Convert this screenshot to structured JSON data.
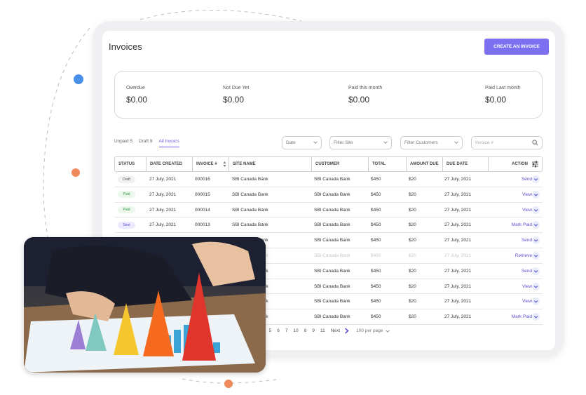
{
  "page": {
    "title": "Invoices",
    "create_label": "CREATE AN INVOICE"
  },
  "summary": [
    {
      "label": "Overdue",
      "value": "$0.00"
    },
    {
      "label": "Not Due Yet",
      "value": "$0.00"
    },
    {
      "label": "Paid this month",
      "value": "$0.00"
    },
    {
      "label": "Paid Last month",
      "value": "$0.00"
    }
  ],
  "tabs": [
    {
      "label": "Unpaid 5",
      "active": false
    },
    {
      "label": "Draft 8",
      "active": false
    },
    {
      "label": "All Invoics",
      "active": true
    }
  ],
  "filters": {
    "date": "Date",
    "site": "Filter Site",
    "customers": "Filter Customers",
    "search_placeholder": "Invoice #"
  },
  "columns": [
    "STATUS",
    "DATE CREATED",
    "INVOICE #",
    "SITE NAME",
    "CUSTOMER",
    "TOTAL",
    "AMOUNT DUE",
    "DUE DATE",
    "ACTION"
  ],
  "rows": [
    {
      "status": "Draft",
      "date": "27 July, 2021",
      "invoice": "000016",
      "site": "SBI Canada Bank",
      "customer": "SBI Canada Bank",
      "total": "$450",
      "due": "$20",
      "due_date": "27 July, 2021",
      "action": "Send"
    },
    {
      "status": "Paid",
      "date": "27 July, 2021",
      "invoice": "000015",
      "site": "SBI Canada Bank",
      "customer": "SBI Canada Bank",
      "total": "$450",
      "due": "$20",
      "due_date": "27 July, 2021",
      "action": "View"
    },
    {
      "status": "Paid",
      "date": "27 July, 2021",
      "invoice": "000014",
      "site": "SBI Canada Bank",
      "customer": "SBI Canada Bank",
      "total": "$450",
      "due": "$20",
      "due_date": "27 July, 2021",
      "action": "View"
    },
    {
      "status": "Sent",
      "date": "27 July, 2021",
      "invoice": "000013",
      "site": "SBI Canada Bank",
      "customer": "SBI Canada Bank",
      "total": "$450",
      "due": "$20",
      "due_date": "27 July, 2021",
      "action": "Mark Paid"
    },
    {
      "status": "",
      "date": "",
      "invoice": "",
      "site": "SBI Canada Bank",
      "customer": "SBI Canada Bank",
      "total": "$450",
      "due": "$20",
      "due_date": "27 July, 2021",
      "action": "Send"
    },
    {
      "status": "",
      "date": "",
      "invoice": "",
      "site": "SBI Canada Bank",
      "customer": "SBI Canada Bank",
      "total": "$450",
      "due": "$20",
      "due_date": "27 July, 2021",
      "action": "Retrieve",
      "faded": true
    },
    {
      "status": "",
      "date": "",
      "invoice": "",
      "site": "SBI Canada Bank",
      "customer": "SBI Canada Bank",
      "total": "$450",
      "due": "$20",
      "due_date": "27 July, 2021",
      "action": "Send"
    },
    {
      "status": "",
      "date": "",
      "invoice": "",
      "site": "SBI Canada Bank",
      "customer": "SBI Canada Bank",
      "total": "$450",
      "due": "$20",
      "due_date": "27 July, 2021",
      "action": "View"
    },
    {
      "status": "",
      "date": "",
      "invoice": "",
      "site": "SBI Canada Bank",
      "customer": "SBI Canada Bank",
      "total": "$450",
      "due": "$20",
      "due_date": "27 July, 2021",
      "action": "View"
    },
    {
      "status": "",
      "date": "",
      "invoice": "",
      "site": "SBI Canada Bank",
      "customer": "SBI Canada Bank",
      "total": "$450",
      "due": "$20",
      "due_date": "27 July, 2021",
      "action": "Mark Paid"
    }
  ],
  "pagination": {
    "pages": [
      "4",
      "5",
      "6",
      "7",
      "10",
      "8",
      "9",
      "11"
    ],
    "next_label": "Next",
    "per_page": "100 per page"
  },
  "colors": {
    "accent": "#7c6ff0",
    "dot_blue": "#4a8fe8",
    "dot_orange": "#ef8a5a"
  },
  "icons": [
    "search-icon",
    "sort-icon",
    "chevron-down-icon",
    "chevron-right-icon",
    "settings-sliders-icon"
  ]
}
